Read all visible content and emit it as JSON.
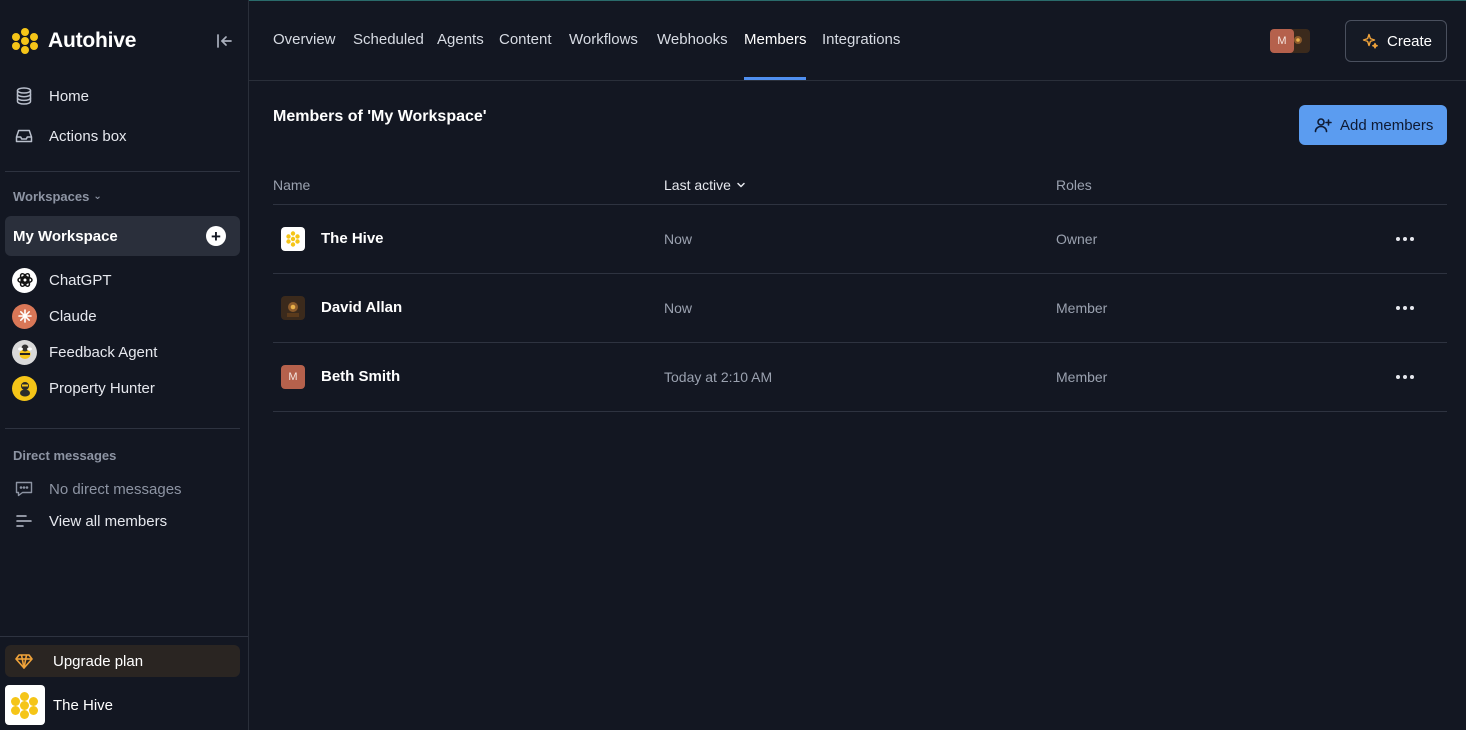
{
  "app": {
    "brand_name": "Autohive"
  },
  "sidebar": {
    "nav": [
      {
        "label": "Home",
        "icon": "database-icon"
      },
      {
        "label": "Actions box",
        "icon": "inbox-icon"
      }
    ],
    "workspaces_label": "Workspaces",
    "current_workspace": "My Workspace",
    "agents": [
      {
        "label": "ChatGPT",
        "icon": "chatgpt-icon"
      },
      {
        "label": "Claude",
        "icon": "claude-icon"
      },
      {
        "label": "Feedback Agent",
        "icon": "bee-avatar-icon"
      },
      {
        "label": "Property Hunter",
        "icon": "bee-avatar-icon"
      }
    ],
    "direct_messages_label": "Direct messages",
    "no_dms": "No direct messages",
    "view_all_members": "View all members",
    "upgrade_label": "Upgrade plan",
    "user_name": "The Hive"
  },
  "topnav": {
    "tabs": [
      "Overview",
      "Scheduled",
      "Agents",
      "Content",
      "Workflows",
      "Webhooks",
      "Members",
      "Integrations"
    ],
    "active_tab": "Members",
    "avatar_initial": "M",
    "create_label": "Create"
  },
  "main": {
    "title": "Members of 'My Workspace'",
    "add_members_label": "Add members",
    "columns": {
      "name": "Name",
      "last_active": "Last active",
      "roles": "Roles"
    },
    "members": [
      {
        "name": "The Hive",
        "last_active": "Now",
        "role": "Owner",
        "avatar": "hive"
      },
      {
        "name": "David Allan",
        "last_active": "Now",
        "role": "Member",
        "avatar": "photo"
      },
      {
        "name": "Beth Smith",
        "last_active": "Today at 2:10 AM",
        "role": "Member",
        "avatar": "M"
      }
    ]
  },
  "colors": {
    "background": "#131722",
    "accent": "#5b9cf0",
    "brand_yellow": "#f5c518",
    "upgrade_orange": "#f0a33a"
  }
}
